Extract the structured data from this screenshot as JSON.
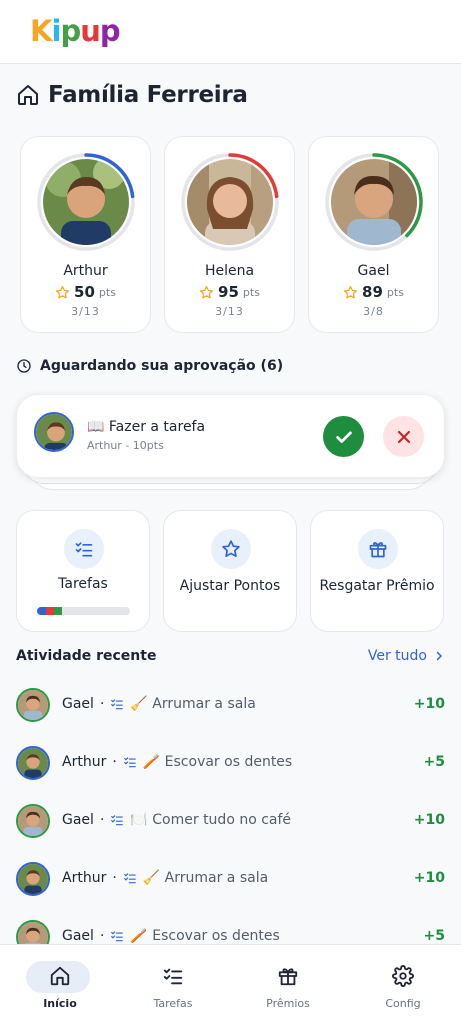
{
  "app": {
    "logo_text": "Kipup",
    "logo_colors": [
      "#f5a623",
      "#29b6f6",
      "#43a047",
      "#e53935",
      "#8e24aa"
    ]
  },
  "family": {
    "title": "Família Ferreira",
    "icon": "home-icon"
  },
  "kids": [
    {
      "name": "Arthur",
      "points": "50",
      "unit": "pts",
      "count": "3/13",
      "ring_color": "#2f63d6",
      "progress": 0.23
    },
    {
      "name": "Helena",
      "points": "95",
      "unit": "pts",
      "count": "3/13",
      "ring_color": "#e53935",
      "progress": 0.23
    },
    {
      "name": "Gael",
      "points": "89",
      "unit": "pts",
      "count": "3/8",
      "ring_color": "#2a9a45",
      "progress": 0.375
    }
  ],
  "approval": {
    "section_label": "Aguardando sua aprovação (6)",
    "task": "📖 Fazer a tarefa",
    "subtitle": "Arthur - 10pts",
    "approve_icon": "check-icon",
    "reject_icon": "close-icon"
  },
  "actions": [
    {
      "label": "Tarefas",
      "icon": "checklist-icon",
      "progress_segments": [
        "#2f63d6",
        "#e53935",
        "#2a9a45"
      ]
    },
    {
      "label": "Ajustar Pontos",
      "icon": "star-icon"
    },
    {
      "label": "Resgatar Prêmio",
      "icon": "gift-icon"
    }
  ],
  "recent": {
    "title": "Atividade recente",
    "link": "Ver tudo",
    "items": [
      {
        "kid": "Gael",
        "sep": "·",
        "task": "🧹 Arrumar a sala",
        "points": "+10",
        "avatar": "g"
      },
      {
        "kid": "Arthur",
        "sep": "·",
        "task": "🪥 Escovar os dentes",
        "points": "+5",
        "avatar": "a"
      },
      {
        "kid": "Gael",
        "sep": "·",
        "task": "🍽️ Comer tudo no café",
        "points": "+10",
        "avatar": "g"
      },
      {
        "kid": "Arthur",
        "sep": "·",
        "task": "🧹 Arrumar a sala",
        "points": "+10",
        "avatar": "a"
      },
      {
        "kid": "Gael",
        "sep": "·",
        "task": "🪥 Escovar os dentes",
        "points": "+5",
        "avatar": "g"
      }
    ]
  },
  "nav": [
    {
      "label": "Início",
      "icon": "home-icon",
      "active": true
    },
    {
      "label": "Tarefas",
      "icon": "checklist-icon",
      "active": false
    },
    {
      "label": "Prêmios",
      "icon": "gift-icon",
      "active": false
    },
    {
      "label": "Config",
      "icon": "gear-icon",
      "active": false
    }
  ]
}
